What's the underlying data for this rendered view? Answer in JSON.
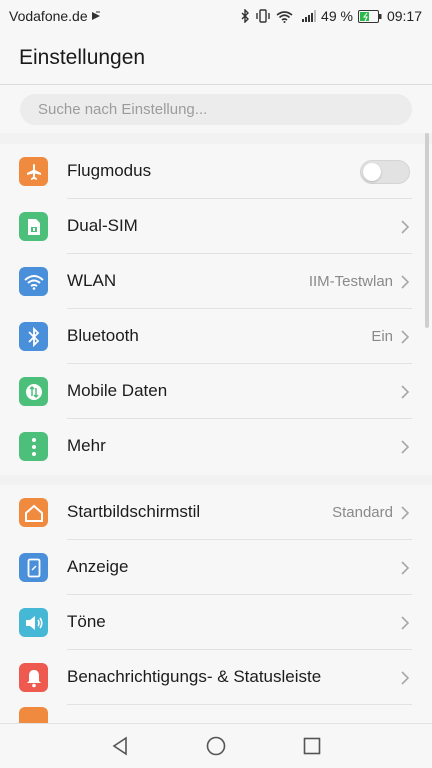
{
  "status_bar": {
    "carrier": "Vodafone.de",
    "battery_percent": "49 %",
    "time": "09:17"
  },
  "header": {
    "title": "Einstellungen"
  },
  "search": {
    "placeholder": "Suche nach Einstellung..."
  },
  "group1": [
    {
      "label": "Flugmodus",
      "icon": "airplane-icon",
      "color": "#f08a3e",
      "toggle": false
    },
    {
      "label": "Dual-SIM",
      "icon": "sim-icon",
      "color": "#4cc07a"
    },
    {
      "label": "WLAN",
      "icon": "wifi-icon",
      "color": "#4a8fd9",
      "value": "IIM-Testwlan"
    },
    {
      "label": "Bluetooth",
      "icon": "bluetooth-icon",
      "color": "#4a8fd9",
      "value": "Ein"
    },
    {
      "label": "Mobile Daten",
      "icon": "mobile-data-icon",
      "color": "#4cc07a"
    },
    {
      "label": "Mehr",
      "icon": "more-icon",
      "color": "#4cc07a"
    }
  ],
  "group2": [
    {
      "label": "Startbildschirmstil",
      "icon": "home-icon",
      "color": "#f08a3e",
      "value": "Standard"
    },
    {
      "label": "Anzeige",
      "icon": "display-icon",
      "color": "#4a8fd9"
    },
    {
      "label": "Töne",
      "icon": "speaker-icon",
      "color": "#45b8d6"
    },
    {
      "label": "Benachrichtigungs- & Statusleiste",
      "icon": "bell-icon",
      "color": "#ee5a4f"
    }
  ]
}
